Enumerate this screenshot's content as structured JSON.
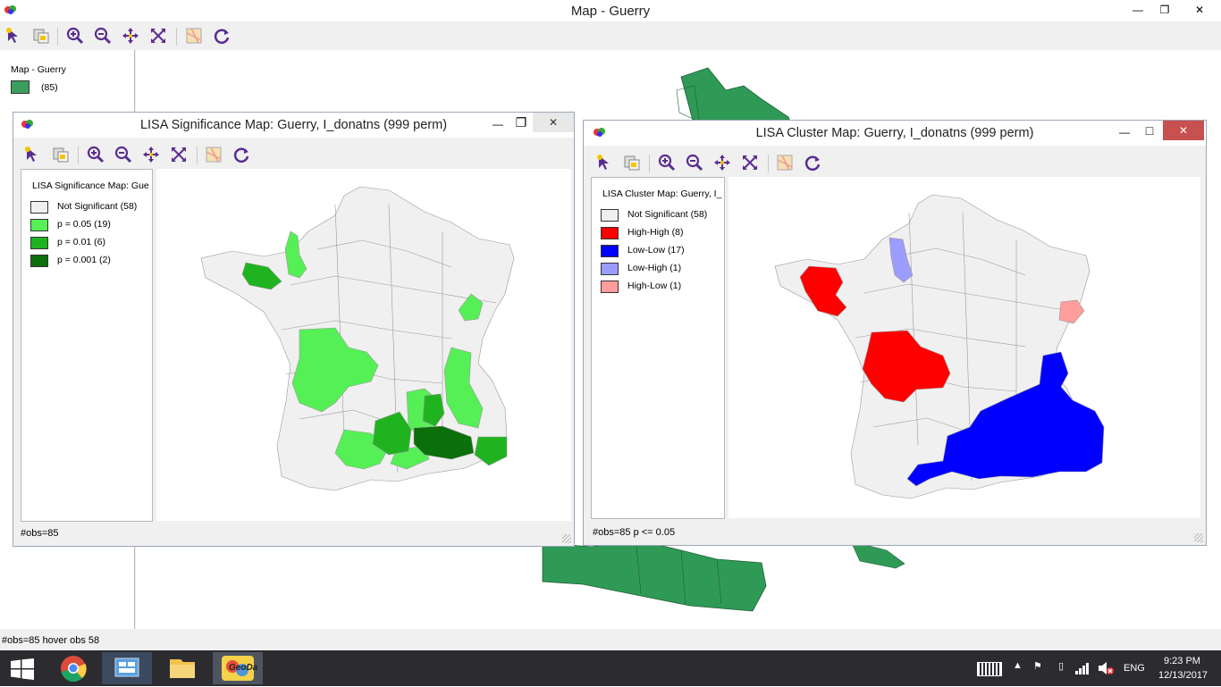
{
  "main": {
    "title": "Map - Guerry",
    "legend_title": "Map - Guerry",
    "legend_item": "(85)",
    "legend_color": "#3a9e5c",
    "map_color": "#2f9a56",
    "status": "#obs=85 hover obs 58"
  },
  "toolbar_icons": [
    "select-icon",
    "copy-icon",
    "zoom-in-icon",
    "zoom-out-icon",
    "pan-icon",
    "fit-extent-icon",
    "map-layer-icon",
    "refresh-icon"
  ],
  "window_controls": {
    "minimize": "—",
    "maximize": "❐",
    "close": "✕"
  },
  "significance": {
    "title": "LISA Significance Map: Guerry, I_donatns (999 perm)",
    "legend_title": "LISA Significance Map: Gue",
    "items": [
      {
        "label": "Not Significant (58)",
        "color": "#f0f0f0"
      },
      {
        "label": "p = 0.05 (19)",
        "color": "#55f055"
      },
      {
        "label": "p = 0.01 (6)",
        "color": "#1fb41f"
      },
      {
        "label": "p = 0.001 (2)",
        "color": "#0b6f0b"
      }
    ],
    "status": "#obs=85"
  },
  "cluster": {
    "title": "LISA Cluster Map: Guerry, I_donatns (999 perm)",
    "legend_title": "LISA Cluster Map: Guerry, I_",
    "items": [
      {
        "label": "Not Significant (58)",
        "color": "#f0f0f0"
      },
      {
        "label": "High-High (8)",
        "color": "#ff0000"
      },
      {
        "label": "Low-Low (17)",
        "color": "#0000ff"
      },
      {
        "label": "Low-High (1)",
        "color": "#9c9cff"
      },
      {
        "label": "High-Low (1)",
        "color": "#ff9c9c"
      }
    ],
    "status": "#obs=85  p <= 0.05"
  },
  "taskbar": {
    "apps": [
      "chrome-icon",
      "control-panel-icon",
      "file-explorer-icon",
      "geoda-icon"
    ],
    "geoda_label": "GeoDa",
    "lang": "ENG",
    "time": "9:23 PM",
    "date": "12/13/2017"
  }
}
